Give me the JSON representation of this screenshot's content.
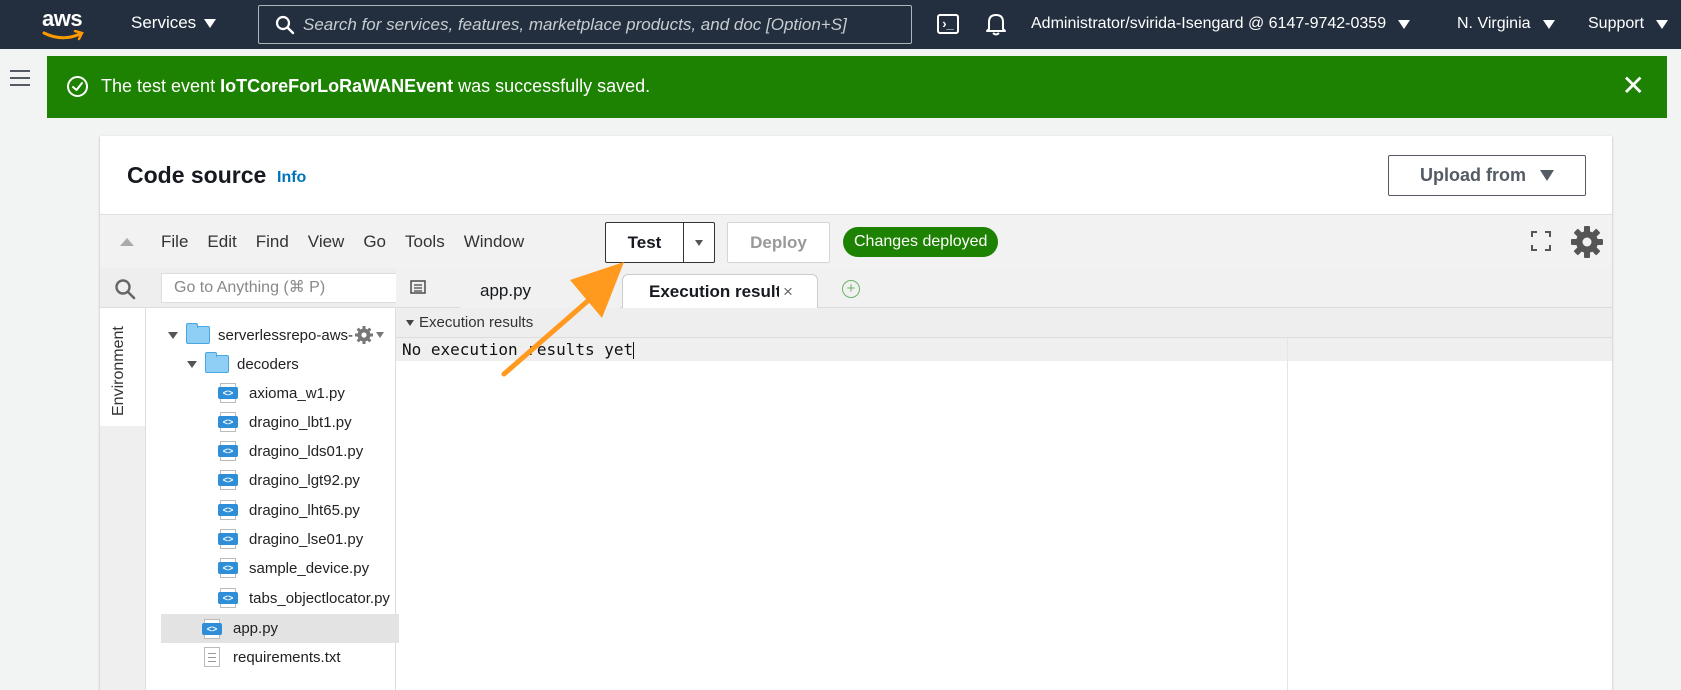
{
  "topnav": {
    "logo_text": "aws",
    "services_label": "Services",
    "search_placeholder": "Search for services, features, marketplace products, and doc [Option+S]",
    "account_label": "Administrator/svirida-Isengard @ 6147-9742-0359",
    "region_label": "N. Virginia",
    "support_label": "Support"
  },
  "flash": {
    "message_prefix": "The test event ",
    "event_name": "IoTCoreForLoRaWANEvent",
    "message_suffix": " was successfully saved.",
    "close_symbol": "✕",
    "color": "#1d8102"
  },
  "panel": {
    "title": "Code source",
    "info_link": "Info",
    "upload_label": "Upload from"
  },
  "ide": {
    "menu": [
      "File",
      "Edit",
      "Find",
      "View",
      "Go",
      "Tools",
      "Window"
    ],
    "test_label": "Test",
    "deploy_label": "Deploy",
    "status_badge": "Changes deployed",
    "goto_placeholder": "Go to Anything (⌘ P)",
    "env_tab_label": "Environment"
  },
  "tree": {
    "root_folder": "serverlessrepo-aws-",
    "sub_folder": "decoders",
    "decoder_files": [
      "axioma_w1.py",
      "dragino_lbt1.py",
      "dragino_lds01.py",
      "dragino_lgt92.py",
      "dragino_lht65.py",
      "dragino_lse01.py",
      "sample_device.py",
      "tabs_objectlocator.py"
    ],
    "app_file": "app.py",
    "requirements_file": "requirements.txt"
  },
  "editor": {
    "tab_app": "app.py",
    "tab_exec": "Execution results",
    "tab_close": "×",
    "exec_header": "Execution results",
    "exec_output": "No execution results yet"
  }
}
